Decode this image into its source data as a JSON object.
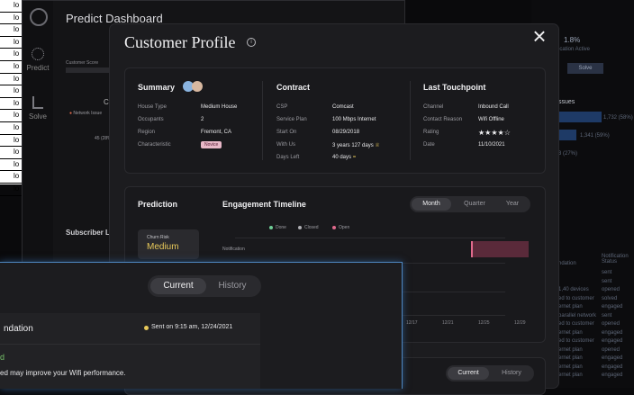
{
  "back_table": {
    "cell": "lo"
  },
  "dashboard": {
    "title": "Predict Dashboard",
    "rail": [
      "Predict",
      "Solve"
    ],
    "labels": {
      "customer_score": "Customer Score",
      "subscriber": "Subscriber L",
      "chart_letter": "Ch",
      "network_issue": "Network Issue",
      "pct": "45 (28%"
    }
  },
  "right_backdrop": {
    "pct": "1.8%",
    "pct_label": "ication Active",
    "solve_btn": "Solve",
    "issues_header": "ssues",
    "bar_values": [
      "1,732 (58%)",
      "1,341 (59%)",
      "3 (27%)"
    ],
    "table_header": [
      "ndation",
      "Notification Status"
    ],
    "rows": [
      [
        "",
        "sent"
      ],
      [
        "",
        "sent"
      ],
      [
        "1,40 devices",
        "opened"
      ],
      [
        "ed to customer",
        "solved"
      ],
      [
        "ernet plan",
        "engaged"
      ],
      [
        "parallel network",
        "sent"
      ],
      [
        "ed to customer",
        "opened"
      ],
      [
        "ernet plan",
        "engaged"
      ],
      [
        "ed to customer",
        "engaged"
      ],
      [
        "ernet plan",
        "opened"
      ],
      [
        "ernet plan",
        "engaged"
      ],
      [
        "ernet plan",
        "engaged"
      ],
      [
        "ernet plan",
        "engaged"
      ]
    ]
  },
  "modal": {
    "title": "Customer Profile",
    "info_icon": "ⓘ",
    "close_icon": "×",
    "summary": {
      "heading": "Summary",
      "fields": [
        {
          "label": "House Type",
          "value": "Medium House"
        },
        {
          "label": "Occupants",
          "value": "2"
        },
        {
          "label": "Region",
          "value": "Fremont, CA"
        },
        {
          "label": "Characteristic",
          "value": "Novice"
        }
      ]
    },
    "contract": {
      "heading": "Contract",
      "fields": [
        {
          "label": "CSP",
          "value": "Comcast"
        },
        {
          "label": "Service Plan",
          "value": "100 Mbps Internet"
        },
        {
          "label": "Start On",
          "value": "08/29/2018"
        },
        {
          "label": "With Us",
          "value": "3 years 127 days"
        },
        {
          "label": "Days Left",
          "value": "40 days"
        }
      ]
    },
    "touchpoint": {
      "heading": "Last Touchpoint",
      "fields": [
        {
          "label": "Channel",
          "value": "Inbound Call"
        },
        {
          "label": "Contact Reason",
          "value": "Wifi Offline"
        },
        {
          "label": "Rating",
          "value": "★★★★☆"
        },
        {
          "label": "Date",
          "value": "11/10/2021"
        }
      ]
    },
    "prediction": {
      "heading": "Prediction",
      "churn_label": "Churn Risk",
      "churn_value": "Medium"
    },
    "timeline": {
      "heading": "Engagement Timeline",
      "tabs": [
        "Month",
        "Quarter",
        "Year"
      ],
      "active_tab": "Month",
      "legend": [
        {
          "label": "Done",
          "color": "#6fcf97"
        },
        {
          "label": "Closed",
          "color": "#b0b0b5"
        },
        {
          "label": "Open",
          "color": "#e06a8c"
        }
      ],
      "row_label": "Notification",
      "ticks": [
        "12/17",
        "12/21",
        "12/25",
        "12/29"
      ]
    },
    "bottom_tabs": [
      "Current",
      "History"
    ]
  },
  "front_panel": {
    "tabs": [
      "Current",
      "History"
    ],
    "rec_title": "ndation",
    "sent": "Sent on 9:15 am, 12/24/2021",
    "green_line": "d",
    "body": "ed may improve your Wifi performance."
  },
  "float_table": {
    "rows": [
      [
        "out to customer",
        "opened"
      ],
      [
        "out to customer",
        "engaged"
      ],
      [
        "out to customer",
        "engaged"
      ],
      [
        "out to customer",
        "engaged"
      ],
      [
        "nternet plan",
        "engaged"
      ],
      [
        "",
        "opened"
      ],
      [
        "out to customer",
        "engaged"
      ],
      [
        "out to customer",
        "engaged"
      ],
      [
        "parallel network",
        "engaged"
      ],
      [
        "out to customer",
        "solved"
      ],
      [
        "",
        "engaged"
      ]
    ]
  }
}
